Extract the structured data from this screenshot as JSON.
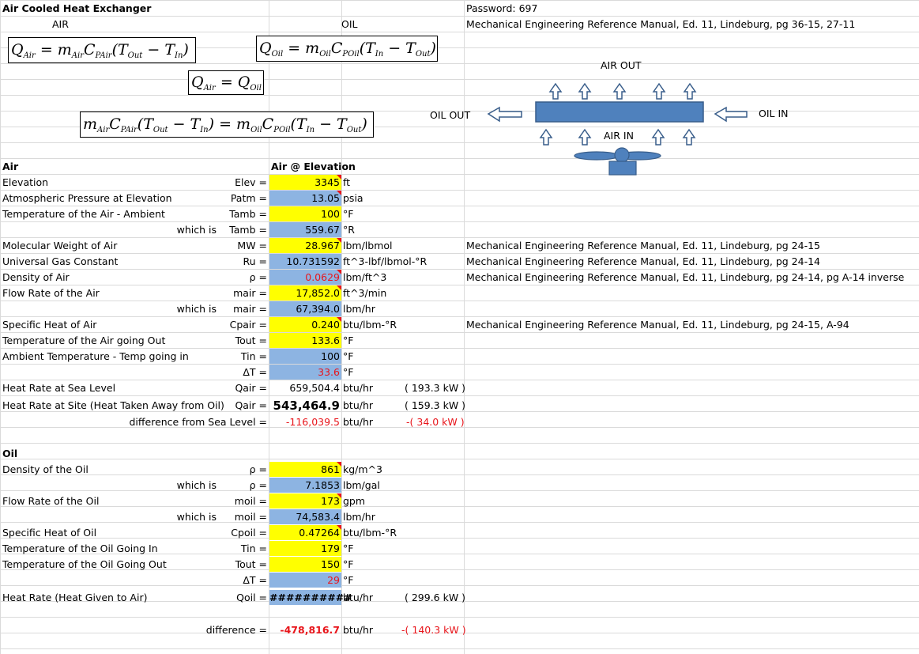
{
  "header": {
    "title": "Air Cooled Heat Exchanger",
    "col_air": "AIR",
    "col_oil": "OIL",
    "password": "Password: 697",
    "reference": "Mechanical Engineering Reference Manual, Ed. 11, Lindeburg, pg 36-15, 27-11"
  },
  "diagram": {
    "air_out": "AIR OUT",
    "air_in": "AIR IN",
    "oil_out": "OIL OUT",
    "oil_in": "OIL IN",
    "colors": {
      "fill": "#4f81bd",
      "stroke": "#385d8a"
    }
  },
  "equations": {
    "q_air": "Q_Air = m_Air C_PAir (T_Out − T_In)",
    "q_oil": "Q_Oil = m_Oil C_POil (T_In − T_Out)",
    "equal": "Q_Air = Q_Oil",
    "combined": "m_Air C_PAir (T_Out − T_In) = m_Oil C_POil (T_In − T_Out)"
  },
  "air": {
    "section": "Air",
    "header": "Air @ Elevation",
    "rows": {
      "elev": {
        "label": "Elevation",
        "sym": "Elev =",
        "value": "3345",
        "unit": "ft"
      },
      "patm": {
        "label": "Atmospheric Pressure at Elevation",
        "sym": "Patm =",
        "value": "13.05",
        "unit": "psia"
      },
      "tamb": {
        "label": "Temperature of the Air - Ambient",
        "sym": "Tamb =",
        "value": "100",
        "unit": "°F"
      },
      "tamb_r": {
        "which": "which is",
        "sym": "Tamb =",
        "value": "559.67",
        "unit": "°R"
      },
      "mw": {
        "label": "Molecular Weight of Air",
        "sym": "MW =",
        "value": "28.967",
        "unit": "lbm/lbmol",
        "ref": "Mechanical Engineering Reference Manual, Ed. 11, Lindeburg, pg 24-15"
      },
      "ru": {
        "label": "Universal Gas Constant",
        "sym": "Ru =",
        "value": "10.731592",
        "unit": "ft^3-lbf/lbmol-°R",
        "ref": "Mechanical Engineering Reference Manual, Ed. 11, Lindeburg, pg 24-14"
      },
      "rho": {
        "label": "Density of Air",
        "sym": "ρ =",
        "value": "0.0629",
        "unit": "lbm/ft^3",
        "ref": "Mechanical Engineering Reference Manual, Ed. 11, Lindeburg, pg 24-14, pg A-14 inverse"
      },
      "mair": {
        "label": "Flow Rate of the Air",
        "sym": "mair =",
        "value": "17,852.0",
        "unit": "ft^3/min"
      },
      "mair2": {
        "which": "which is",
        "sym": "mair =",
        "value": "67,394.0",
        "unit": "lbm/hr"
      },
      "cpair": {
        "label": "Specific Heat of Air",
        "sym": "Cpair =",
        "value": "0.240",
        "unit": "btu/lbm-°R",
        "ref": "Mechanical Engineering Reference Manual, Ed. 11, Lindeburg, pg 24-15, A-94"
      },
      "tout": {
        "label": "Temperature of the Air going Out",
        "sym": "Tout =",
        "value": "133.6",
        "unit": "°F"
      },
      "tin": {
        "label": "Ambient Temperature - Temp going in",
        "sym": "Tin =",
        "value": "100",
        "unit": "°F"
      },
      "dt": {
        "sym": "ΔT =",
        "value": "33.6",
        "unit": "°F"
      },
      "qsea": {
        "label": "Heat Rate at Sea Level",
        "sym": "Qair =",
        "value": "659,504.4",
        "unit": "btu/hr",
        "kw": "( 193.3 kW )"
      },
      "qsite": {
        "label": "Heat Rate at Site (Heat Taken Away from Oil)",
        "sym": "Qair =",
        "value": "543,464.9",
        "unit": "btu/hr",
        "kw": "( 159.3 kW )"
      },
      "diff": {
        "label": "difference from Sea Level =",
        "value": "-116,039.5",
        "unit": "btu/hr",
        "kw": "-( 34.0 kW )"
      }
    }
  },
  "oil": {
    "section": "Oil",
    "rows": {
      "rho": {
        "label": "Density of the Oil",
        "sym": "ρ =",
        "value": "861",
        "unit": "kg/m^3"
      },
      "rho2": {
        "which": "which is",
        "sym": "ρ =",
        "value": "7.1853",
        "unit": "lbm/gal"
      },
      "moil": {
        "label": "Flow Rate of the Oil",
        "sym": "moil =",
        "value": "173",
        "unit": "gpm"
      },
      "moil2": {
        "which": "which is",
        "sym": "moil =",
        "value": "74,583.4",
        "unit": "lbm/hr"
      },
      "cpoil": {
        "label": "Specific Heat of Oil",
        "sym": "Cpoil =",
        "value": "0.47264",
        "unit": "btu/lbm-°R"
      },
      "tin": {
        "label": "Temperature of the Oil Going In",
        "sym": "Tin =",
        "value": "179",
        "unit": "°F"
      },
      "tout": {
        "label": "Temperature of the Oil Going Out",
        "sym": "Tout =",
        "value": "150",
        "unit": "°F"
      },
      "dt": {
        "sym": "ΔT =",
        "value": "29",
        "unit": "°F"
      },
      "qoil": {
        "label": "Heat Rate (Heat Given to Air)",
        "sym": "Qoil =",
        "value": "##########",
        "unit": "btu/hr",
        "kw": "( 299.6 kW )"
      }
    },
    "difference": {
      "label": "difference =",
      "value": "-478,816.7",
      "unit": "btu/hr",
      "kw": "-( 140.3 kW )"
    }
  }
}
